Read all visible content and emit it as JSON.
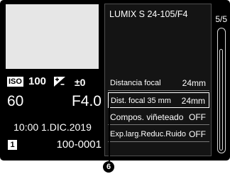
{
  "info": {
    "iso_badge": "ISO",
    "iso_value": "100",
    "ev_icon": "exposure-compensation-icon",
    "ev_value": "±0",
    "shutter": "60",
    "aperture": "F4.0",
    "datetime": "10:00 1.DIC.2019",
    "folder_badge": "1",
    "file_number": "100-0001"
  },
  "menu": {
    "lens": "LUMIX S 24-105/F4",
    "rows": [
      {
        "label": "Distancia focal",
        "value": "24mm"
      },
      {
        "label": "Dist. focal 35 mm",
        "value": "24mm"
      },
      {
        "label": "Compos. viñeteado",
        "value": "OFF"
      },
      {
        "label": "Exp.larg.Reduc.Ruido",
        "value": "OFF"
      }
    ]
  },
  "page_indicator": "5/5",
  "callout": "6"
}
